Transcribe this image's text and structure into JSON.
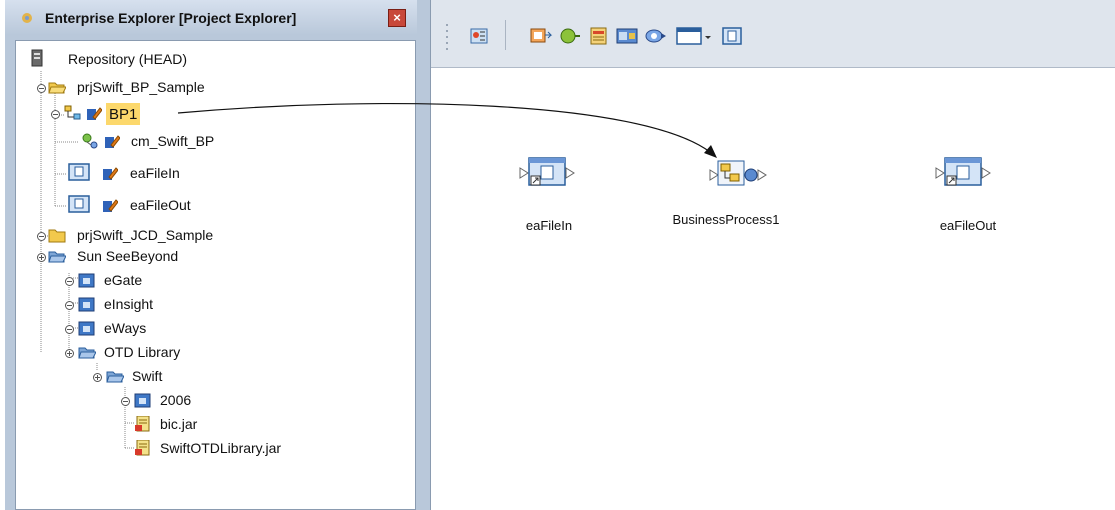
{
  "explorer": {
    "title": "Enterprise Explorer [Project Explorer]",
    "close_label": "×",
    "tree": {
      "repository": "Repository (HEAD)",
      "project1": "prjSwift_BP_Sample",
      "bp1": "BP1",
      "cm": "cm_Swift_BP",
      "eaFileIn": "eaFileIn",
      "eaFileOut": "eaFileOut",
      "project2": "prjSwift_JCD_Sample",
      "sun": "Sun SeeBeyond",
      "egate": "eGate",
      "einsight": "eInsight",
      "eways": "eWays",
      "otd": "OTD Library",
      "swift": "Swift",
      "y2006": "2006",
      "bic": "bic.jar",
      "swiftlib": "SwiftOTDLibrary.jar"
    }
  },
  "canvas": {
    "nodes": {
      "in": "eaFileIn",
      "bp": "BusinessProcess1",
      "out": "eaFileOut"
    }
  },
  "colors": {
    "panel": "#b9c8da",
    "highlight": "#fcd86c",
    "folder": "#f2c94c",
    "accent": "#2f62b8"
  }
}
